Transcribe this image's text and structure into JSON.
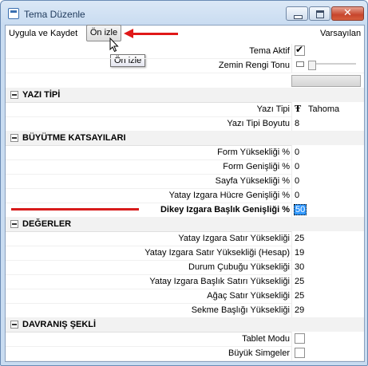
{
  "window": {
    "title": "Tema Düzenle",
    "buttons": {
      "minimize": "minimize-icon",
      "maximize": "maximize-icon",
      "close": "✕"
    }
  },
  "toolbar": {
    "apply_save": "Uygula ve Kaydet",
    "preview": "Ön izle",
    "defaults": "Varsayılan",
    "tooltip": "Ön izle"
  },
  "general": {
    "theme_active_label": "Tema Aktif",
    "theme_active_check": "✔",
    "bg_color_tone_label": "Zemin Rengi Tonu"
  },
  "sections": {
    "font": "YAZI TİPİ",
    "growth": "BÜYÜTME KATSAYILARI",
    "values": "DEĞERLER",
    "behavior": "DAVRANIŞ ŞEKLİ"
  },
  "font": {
    "font_label": "Yazı Tipi",
    "font_icon": "Ŧ",
    "font_value": "Tahoma",
    "size_label": "Yazı Tipi Boyutu",
    "size_value": "8"
  },
  "growth": {
    "rows": [
      {
        "label": "Form Yüksekliği %",
        "value": "0"
      },
      {
        "label": "Form Genişliği %",
        "value": "0"
      },
      {
        "label": "Sayfa Yüksekliği %",
        "value": "0"
      },
      {
        "label": "Yatay Izgara Hücre Genişliği %",
        "value": "0"
      },
      {
        "label": "Dikey Izgara Başlık Genişliği %",
        "value": "50"
      }
    ]
  },
  "values": {
    "rows": [
      {
        "label": "Yatay Izgara Satır Yüksekliği",
        "value": "25"
      },
      {
        "label": "Yatay Izgara Satır Yüksekliği (Hesap)",
        "value": "19"
      },
      {
        "label": "Durum Çubuğu Yüksekliği",
        "value": "30"
      },
      {
        "label": "Yatay Izgara Başlık Satırı Yüksekliği",
        "value": "25"
      },
      {
        "label": "Ağaç Satır Yüksekliği",
        "value": "25"
      },
      {
        "label": "Sekme Başlığı Yüksekliği",
        "value": "29"
      }
    ]
  },
  "behavior": {
    "tablet_mode_label": "Tablet Modu",
    "big_icons_label": "Büyük Simgeler"
  },
  "colors": {
    "annotation": "#e01818",
    "selection": "#3399ff"
  }
}
